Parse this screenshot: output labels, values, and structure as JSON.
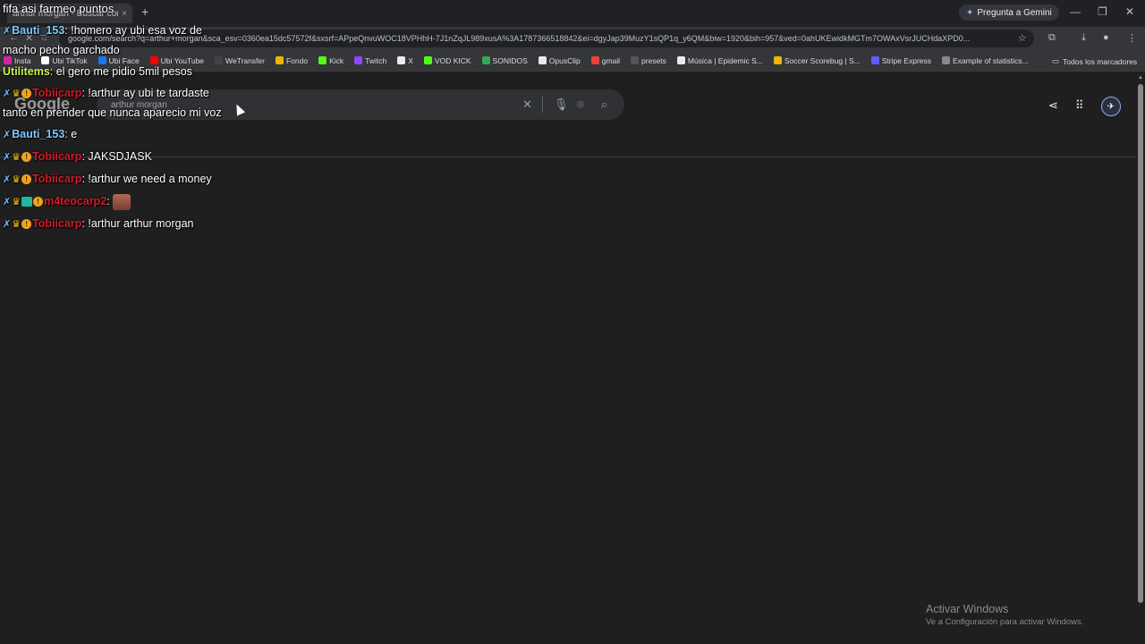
{
  "browser": {
    "tab_title": "arthur morgan - Buscar con G",
    "tab_close": "×",
    "new_tab": "+",
    "gemini_label": "Pregunta a Gemini",
    "window_controls": [
      "—",
      "❐",
      "✕"
    ],
    "url": "google.com/search?q=arthur+morgan&sca_esv=0360ea15dc57572f&sxsrf=APpeQnvuWOC18VPHhH-7J1nZqJL989xusA%3A1787366518842&ei=dgyJap39MuzY1sQP1q_y6QM&biw=1920&bih=957&ved=0ahUKEwidkMGTm7OWAxVsrJUCHdaXPD0...",
    "bookmarks": [
      {
        "label": "Insta",
        "color": "#d6249f"
      },
      {
        "label": "Ubi TikTok",
        "color": "#ffffff"
      },
      {
        "label": "Ubi Face",
        "color": "#1877f2"
      },
      {
        "label": "Ubi YouTube",
        "color": "#ff0000"
      },
      {
        "label": "WeTransfer",
        "color": "#444444"
      },
      {
        "label": "Fondo",
        "color": "#f4b400"
      },
      {
        "label": "Kick",
        "color": "#53fc18"
      },
      {
        "label": "Twitch",
        "color": "#9146ff"
      },
      {
        "label": "X",
        "color": "#e8eaed"
      },
      {
        "label": "VOD KICK",
        "color": "#53fc18"
      },
      {
        "label": "SONIDOS",
        "color": "#34a853"
      },
      {
        "label": "OpusClip",
        "color": "#e8eaed"
      },
      {
        "label": "gmail",
        "color": "#ea4335"
      },
      {
        "label": "presets",
        "color": "#555555"
      },
      {
        "label": "Música | Epidemic S...",
        "color": "#e8eaed"
      },
      {
        "label": "Soccer Scorebug | S...",
        "color": "#f4b400"
      },
      {
        "label": "Stripe Express",
        "color": "#635bff"
      },
      {
        "label": "Example of statistics...",
        "color": "#888888"
      }
    ],
    "bookmarks_folder": "Todos los marcadores"
  },
  "google": {
    "logo": "Google",
    "query": "arthur morgan"
  },
  "chat": {
    "title": "fifa asi farmeo puntos",
    "messages": [
      {
        "user": "Bauti_153",
        "user_color": "#7ec8ff",
        "badges": [
          "sword"
        ],
        "text": "!homero ay ubi esa voz de macho pecho garchado"
      },
      {
        "user": "Utilitems",
        "user_color": "#c7f24f",
        "badges": [],
        "text": "el gero me pidio 5mil pesos"
      },
      {
        "user": "Tobiicarp",
        "user_color": "#d11a2a",
        "badges": [
          "sword",
          "crown",
          "coin"
        ],
        "text": "!arthur ay ubi te tardaste tanto en prender que nunca aparecio mi voz"
      },
      {
        "user": "Bauti_153",
        "user_color": "#7ec8ff",
        "badges": [
          "sword"
        ],
        "text": "e"
      },
      {
        "user": "Tobiicarp",
        "user_color": "#d11a2a",
        "badges": [
          "sword",
          "crown",
          "coin"
        ],
        "text": "JAKSDJASK"
      },
      {
        "user": "Tobiicarp",
        "user_color": "#d11a2a",
        "badges": [
          "sword",
          "crown",
          "coin"
        ],
        "text": "!arthur we need a money"
      },
      {
        "user": "m4teocarp2",
        "user_color": "#d11a2a",
        "badges": [
          "sword",
          "crown",
          "sub",
          "coin"
        ],
        "text": "",
        "emote": true
      },
      {
        "user": "Tobiicarp",
        "user_color": "#d11a2a",
        "badges": [
          "sword",
          "crown",
          "coin"
        ],
        "text": "!arthur arthur morgan"
      }
    ]
  },
  "watermark": {
    "line1": "Activar Windows",
    "line2": "Ve a Configuración para activar Windows."
  }
}
